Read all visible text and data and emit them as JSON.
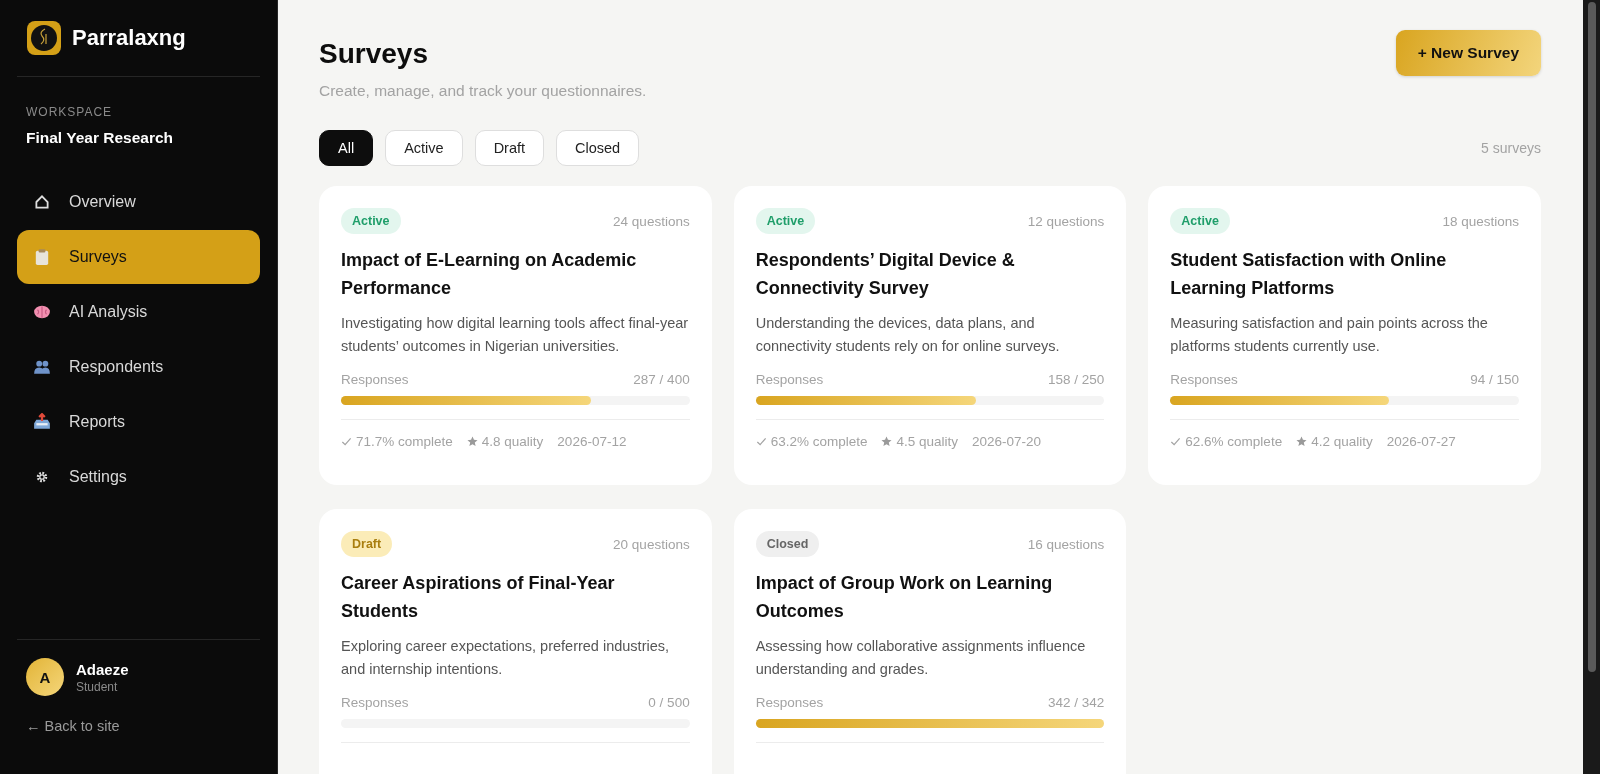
{
  "sidebar": {
    "brand": "Parralaxng",
    "workspace_label": "WORKSPACE",
    "workspace_name": "Final Year Research",
    "items": [
      {
        "label": "Overview",
        "kind": "home",
        "selected": false
      },
      {
        "label": "Surveys",
        "kind": "clipboard",
        "selected": true
      },
      {
        "label": "AI Analysis",
        "kind": "brain",
        "selected": false
      },
      {
        "label": "Respondents",
        "kind": "people",
        "selected": false
      },
      {
        "label": "Reports",
        "kind": "tray",
        "selected": false
      },
      {
        "label": "Settings",
        "kind": "gear",
        "selected": false
      }
    ],
    "user": {
      "initial": "A",
      "name": "Adaeze",
      "role": "Student"
    },
    "back_link": "← Back to site"
  },
  "header": {
    "title": "Surveys",
    "subtitle": "Create, manage, and track your questionnaires.",
    "new_button": "+ New Survey"
  },
  "filters": [
    {
      "label": "All",
      "selected": true
    },
    {
      "label": "Active",
      "selected": false
    },
    {
      "label": "Draft",
      "selected": false
    },
    {
      "label": "Closed",
      "selected": false
    }
  ],
  "count": "5 surveys",
  "surveys": [
    {
      "status": "Active",
      "kind": "active",
      "questions": "24 questions",
      "title": "Impact of E-Learning on Academic Performance",
      "description": "Investigating how digital learning tools affect final-year students’ outcomes in Nigerian universities.",
      "responses_label": "Responses",
      "responses": "287 / 400",
      "level": 0.7175,
      "complete": "71.7% complete",
      "quality": "4.8 quality",
      "date": "2026-07-12"
    },
    {
      "status": "Active",
      "kind": "active",
      "questions": "12 questions",
      "title": "Respondents’ Digital Device & Connectivity Survey",
      "description": "Understanding the devices, data plans, and connectivity students rely on for online surveys.",
      "responses_label": "Responses",
      "responses": "158 / 250",
      "level": 0.632,
      "complete": "63.2% complete",
      "quality": "4.5 quality",
      "date": "2026-07-20"
    },
    {
      "status": "Active",
      "kind": "active",
      "questions": "18 questions",
      "title": "Student Satisfaction with Online Learning Platforms",
      "description": "Measuring satisfaction and pain points across the platforms students currently use.",
      "responses_label": "Responses",
      "responses": "94 / 150",
      "level": 0.627,
      "complete": "62.6% complete",
      "quality": "4.2 quality",
      "date": "2026-07-27"
    },
    {
      "status": "Draft",
      "kind": "draft",
      "questions": "20 questions",
      "title": "Career Aspirations of Final-Year Students",
      "description": "Exploring career expectations, preferred industries, and internship intentions.",
      "responses_label": "Responses",
      "responses": "0 / 500",
      "level": 0
    },
    {
      "status": "Closed",
      "kind": "closed",
      "questions": "16 questions",
      "title": "Impact of Group Work on Learning Outcomes",
      "description": "Assessing how collaborative assignments influence understanding and grades.",
      "responses_label": "Responses",
      "responses": "342 / 342",
      "level": 1
    }
  ]
}
